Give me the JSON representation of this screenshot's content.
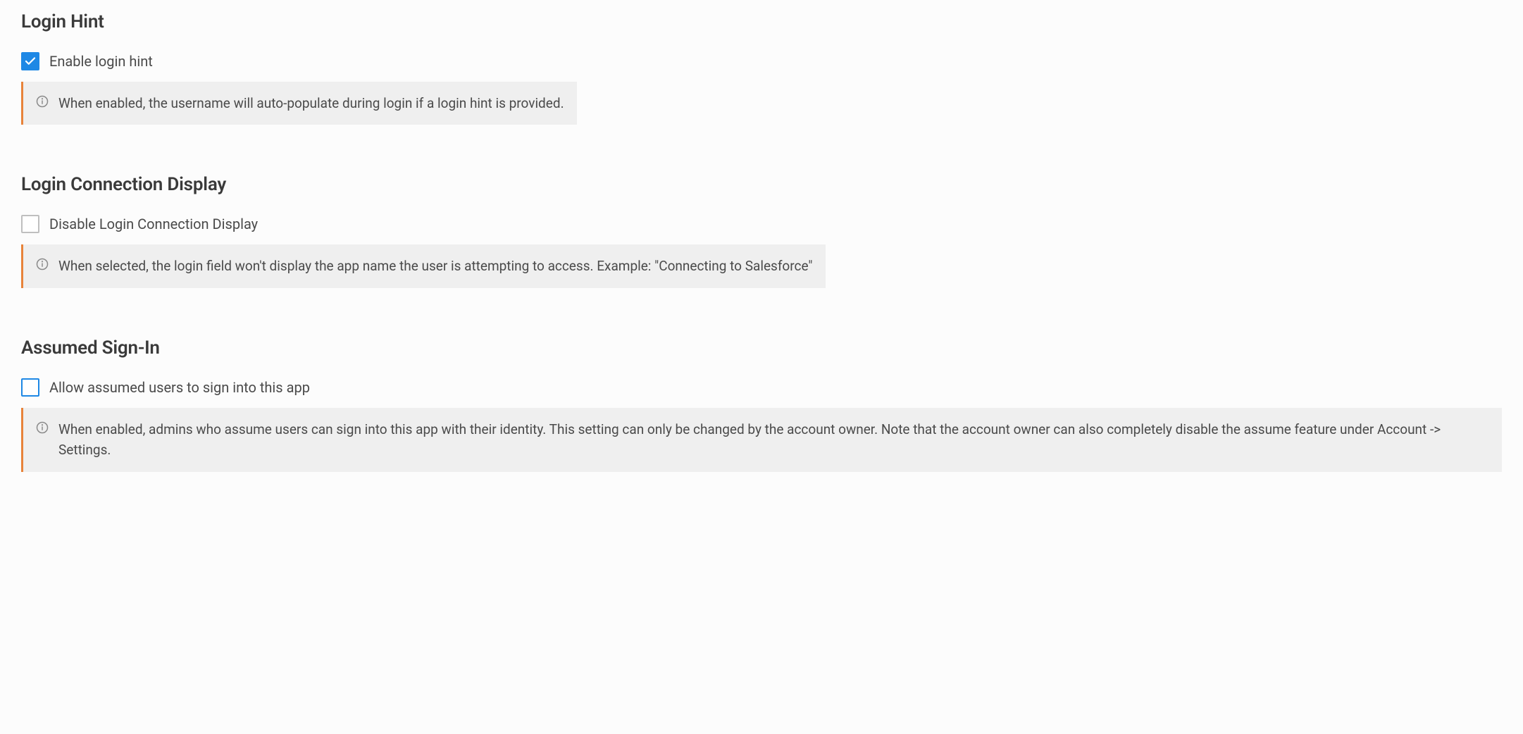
{
  "sections": {
    "login_hint": {
      "title": "Login Hint",
      "checkbox_label": "Enable login hint",
      "checked": true,
      "info": "When enabled, the username will auto-populate during login if a login hint is provided."
    },
    "login_connection_display": {
      "title": "Login Connection Display",
      "checkbox_label": "Disable Login Connection Display",
      "checked": false,
      "info": "When selected, the login field won't display the app name the user is attempting to access. Example: \"Connecting to Salesforce\""
    },
    "assumed_sign_in": {
      "title": "Assumed Sign-In",
      "checkbox_label": "Allow assumed users to sign into this app",
      "checked": false,
      "info": "When enabled, admins who assume users can sign into this app with their identity. This setting can only be changed by the account owner. Note that the account owner can also completely disable the assume feature under Account -> Settings."
    }
  }
}
